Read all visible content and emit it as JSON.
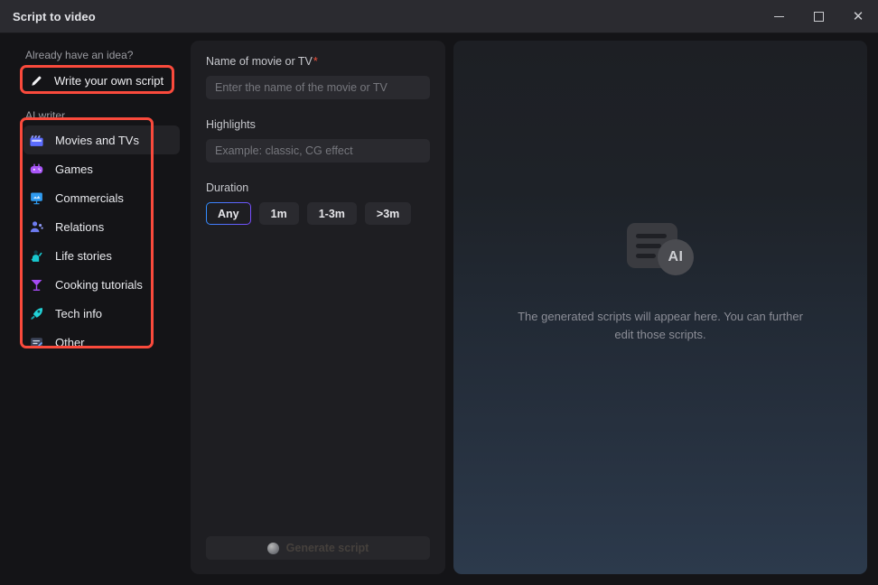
{
  "window": {
    "title": "Script to video",
    "controls": {
      "minimize": "minimize",
      "maximize": "maximize",
      "close": "close"
    }
  },
  "sidebar": {
    "idea_label": "Already have an idea?",
    "own_script": {
      "label": "Write your own script",
      "icon": "pencil-icon"
    },
    "ai_writer_label": "AI writer",
    "items": [
      {
        "label": "Movies and TVs",
        "icon": "clapperboard-icon",
        "active": true,
        "color": "#5b6cff"
      },
      {
        "label": "Games",
        "icon": "gamepad-icon",
        "active": false,
        "color": "#a855f7"
      },
      {
        "label": "Commercials",
        "icon": "presentation-icon",
        "active": false,
        "color": "#2f9bf0"
      },
      {
        "label": "Relations",
        "icon": "people-icon",
        "active": false,
        "color": "#6d7bf0"
      },
      {
        "label": "Life stories",
        "icon": "person-wave-icon",
        "active": false,
        "color": "#18c8cf"
      },
      {
        "label": "Cooking tutorials",
        "icon": "cocktail-glass-icon",
        "active": false,
        "color": "#a64bf4"
      },
      {
        "label": "Tech info",
        "icon": "rocket-icon",
        "active": false,
        "color": "#22d3d8"
      },
      {
        "label": "Other",
        "icon": "document-edit-icon",
        "active": false,
        "color": "#4d7ee8"
      }
    ]
  },
  "form": {
    "name_field": {
      "label": "Name of movie or TV",
      "required_marker": "*",
      "placeholder": "Enter the name of the movie or TV",
      "value": ""
    },
    "highlights_field": {
      "label": "Highlights",
      "placeholder": "Example: classic, CG effect",
      "value": ""
    },
    "duration": {
      "label": "Duration",
      "options": [
        "Any",
        "1m",
        "1-3m",
        ">3m"
      ],
      "selected": "Any"
    },
    "generate_button": {
      "label": "Generate script",
      "state": "loading"
    }
  },
  "preview": {
    "icon": "ai-script-icon",
    "badge_text": "AI",
    "empty_text": "The generated scripts will appear here. You can further edit those scripts."
  },
  "colors": {
    "accent_start": "#2f8fff",
    "accent_end": "#7b4bff",
    "annotation": "#fa4a3c",
    "required": "#f0503c"
  }
}
